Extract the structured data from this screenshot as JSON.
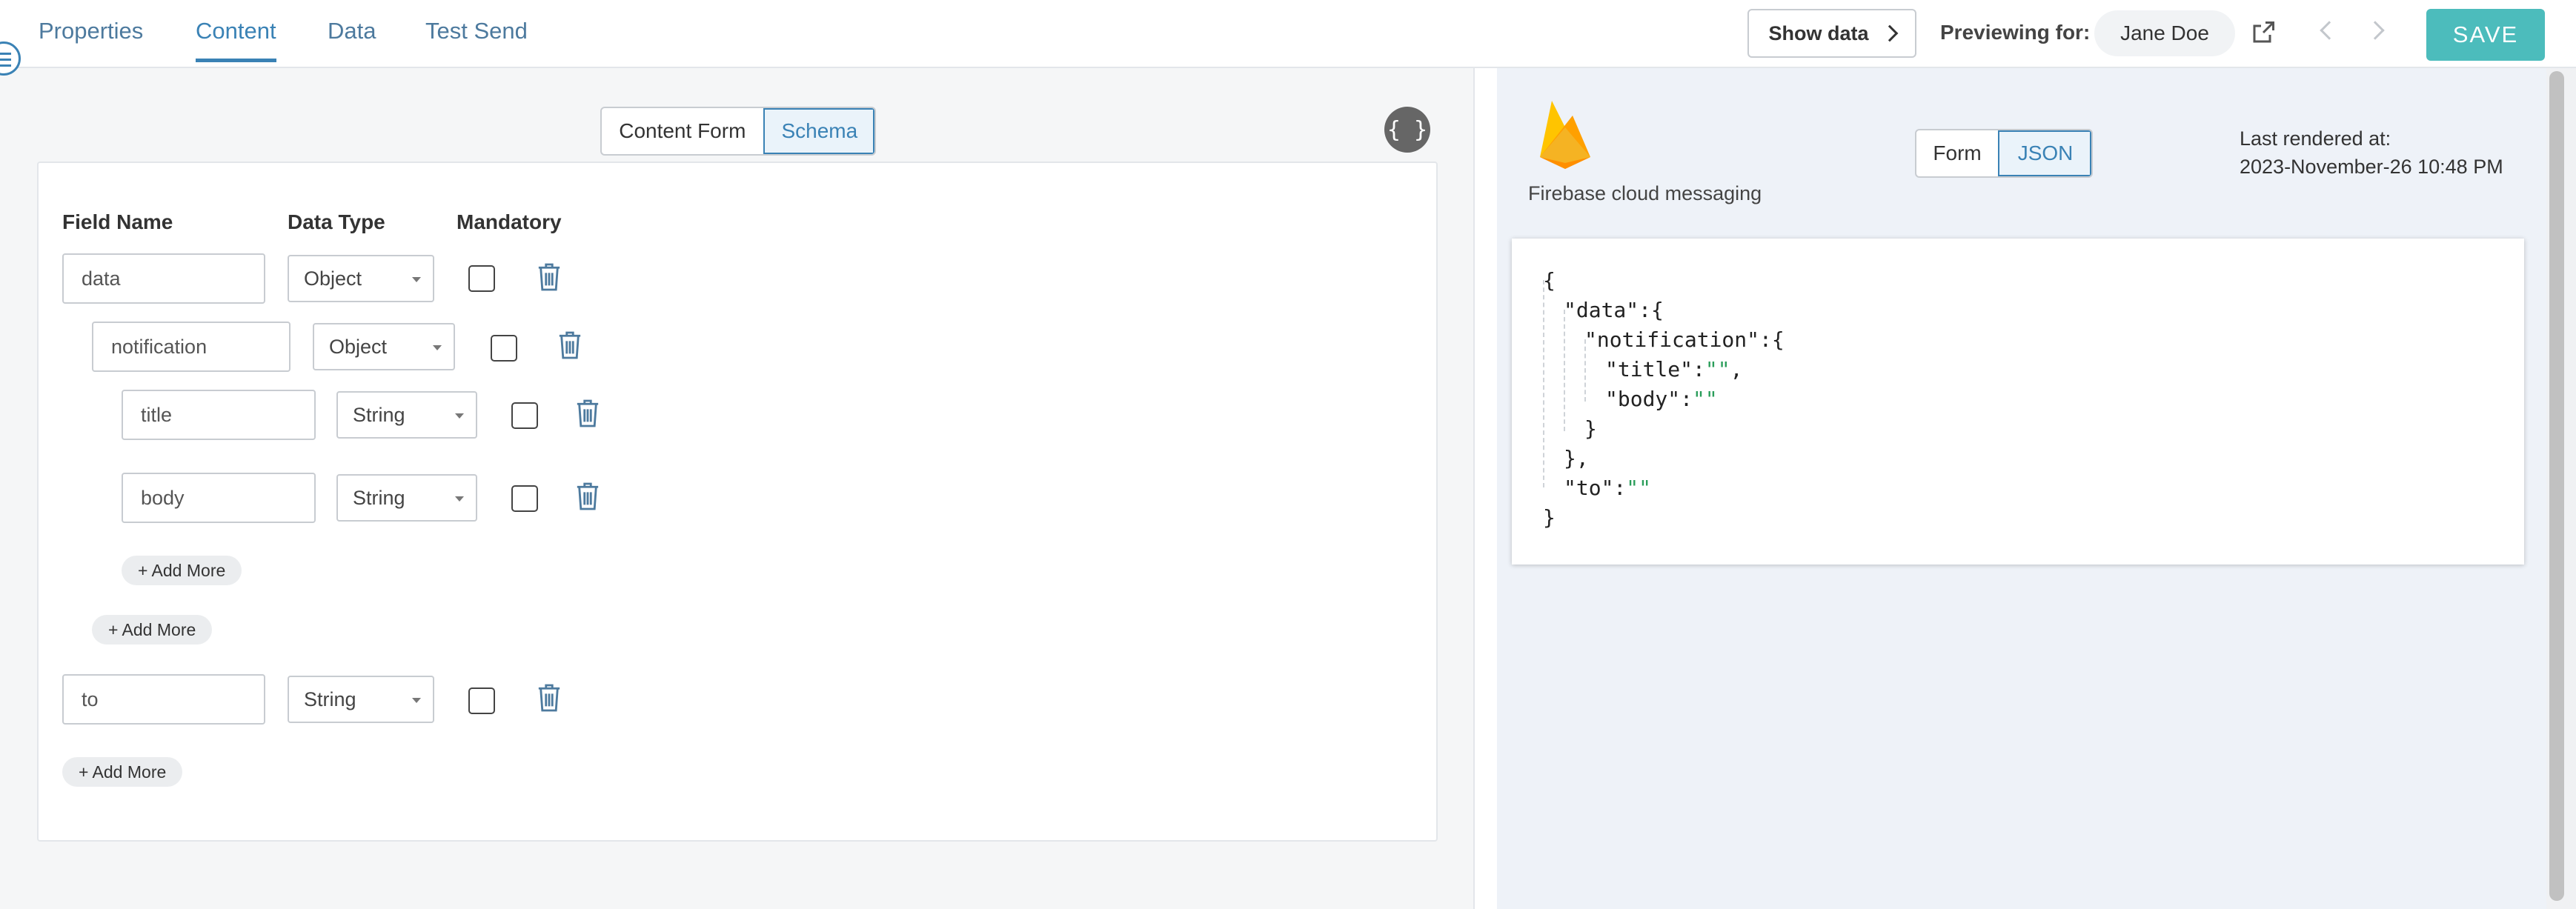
{
  "tabs": [
    {
      "label": "Properties"
    },
    {
      "label": "Content",
      "active": true
    },
    {
      "label": "Data"
    },
    {
      "label": "Test Send"
    }
  ],
  "header": {
    "show_data_label": "Show data",
    "previewing_label": "Previewing for:",
    "preview_user": "Jane Doe",
    "save_label": "SAVE"
  },
  "editor": {
    "mode_toggle": {
      "content_form": "Content Form",
      "schema": "Schema",
      "selected": "Schema"
    },
    "braces_label": "{ }",
    "columns": {
      "field_name": "Field Name",
      "data_type": "Data Type",
      "mandatory": "Mandatory"
    },
    "rows": [
      {
        "field": "data",
        "type": "Object",
        "mandatory": false,
        "level": 0
      },
      {
        "field": "notification",
        "type": "Object",
        "mandatory": false,
        "level": 1
      },
      {
        "field": "title",
        "type": "String",
        "mandatory": false,
        "level": 2
      },
      {
        "field": "body",
        "type": "String",
        "mandatory": false,
        "level": 2
      },
      {
        "field": "to",
        "type": "String",
        "mandatory": false,
        "level": 0
      }
    ],
    "add_more_label": "+ Add More"
  },
  "preview": {
    "channel_label": "Firebase cloud messaging",
    "view_toggle": {
      "form": "Form",
      "json": "JSON",
      "selected": "JSON"
    },
    "last_rendered_label": "Last rendered at:",
    "last_rendered_value": "2023-November-26 10:48 PM",
    "json_lines": [
      {
        "text": "{"
      },
      {
        "text": "\"data\":{"
      },
      {
        "text": "\"notification\":{"
      },
      {
        "key": "\"title\":",
        "value": "\"\"",
        "suffix": ","
      },
      {
        "key": "\"body\":",
        "value": "\"\""
      },
      {
        "text": "}"
      },
      {
        "text": "},"
      },
      {
        "key": "\"to\":",
        "value": "\"\""
      },
      {
        "text": "}"
      }
    ]
  },
  "colors": {
    "accent": "#3a82b5",
    "save": "#4cbcbc",
    "json_string": "#2a9d5a"
  }
}
